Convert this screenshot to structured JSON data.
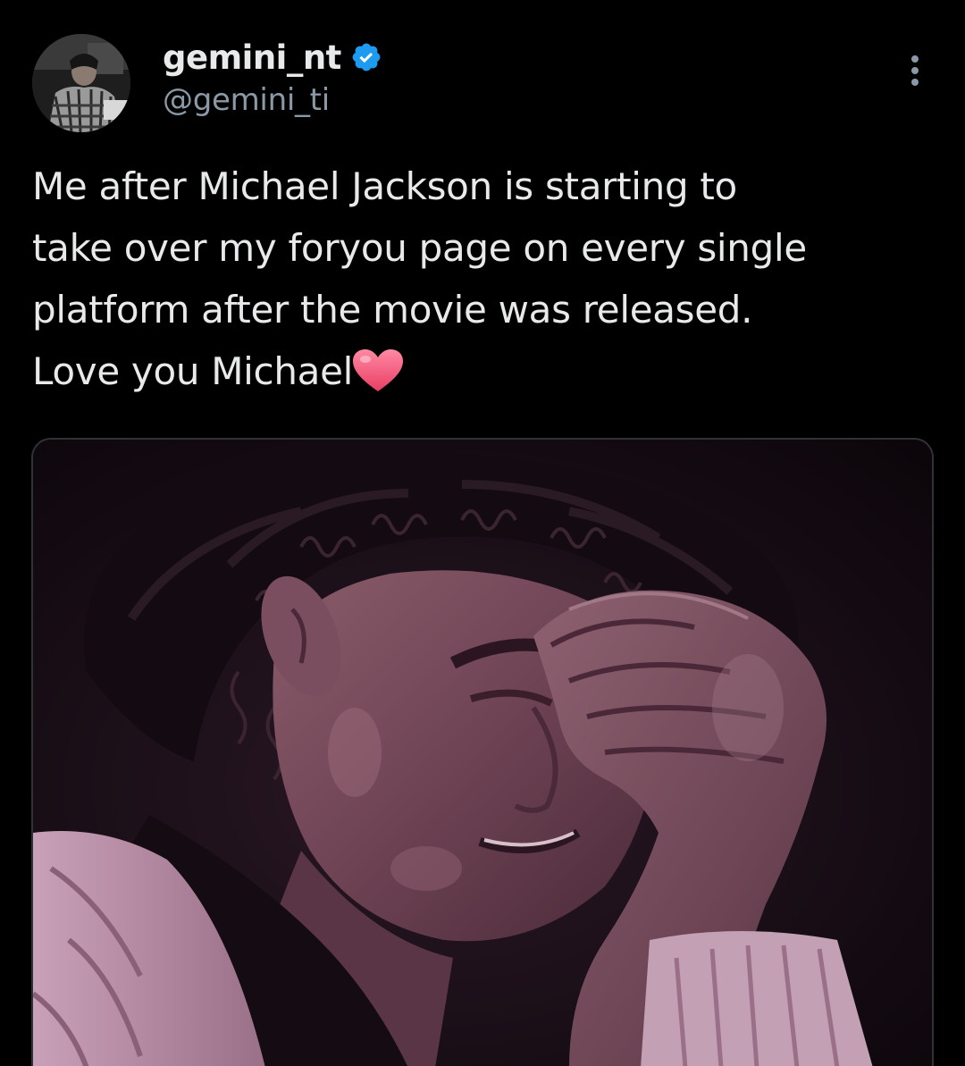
{
  "tweet": {
    "author": {
      "display_name": "gemini_nt",
      "handle": "@gemini_ti",
      "verified": true,
      "avatar_icon": "profile-photo"
    },
    "more_icon": "more-vertical-icon",
    "text_lines": [
      "Me after Michael Jackson is starting to",
      "take over my foryou page on every single",
      "platform after the movie was released.",
      "Love you Michael"
    ],
    "emoji": "heart-emoji",
    "media": {
      "kind": "photo"
    }
  },
  "colors": {
    "background": "#000000",
    "text_primary": "#e7e9ea",
    "text_secondary": "#8b98a5",
    "verified_badge": "#1d9bf0",
    "heart": "#f0607c"
  }
}
